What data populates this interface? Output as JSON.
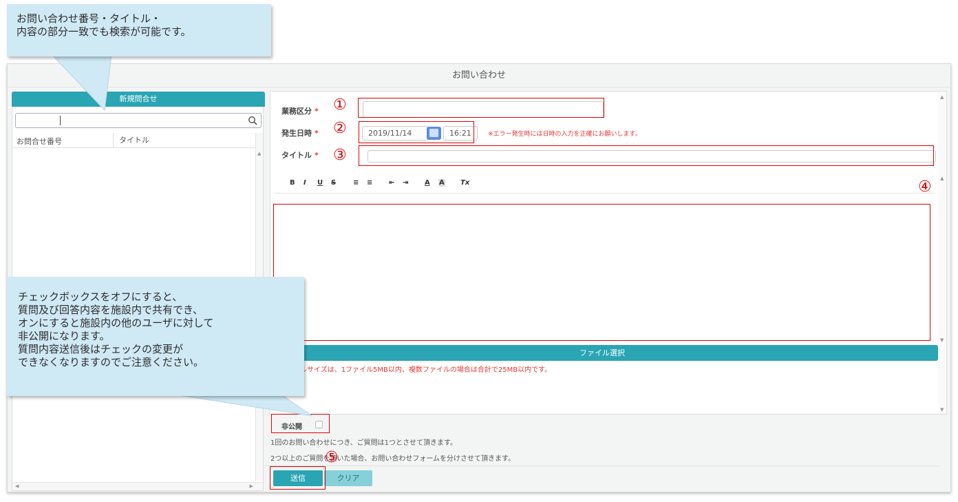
{
  "window": {
    "title": "お問い合わせ"
  },
  "left_panel": {
    "new_button": "新規問合せ",
    "search": {
      "value": "",
      "icon": "search-icon"
    },
    "columns": [
      "お問合せ番号",
      "タイトル"
    ]
  },
  "form": {
    "business_label": "業務区分",
    "date_label": "発生日時",
    "date_value": "2019/11/14",
    "time_value": "16:21",
    "error_note": "※エラー発生時には日時の入力を正確にお願いします。",
    "title_label": "タイトル",
    "required_mark": "*",
    "toolbar": {
      "bold": "B",
      "italic": "I",
      "underline": "U",
      "strike": "S",
      "ordered_list": "≡",
      "bullet_list": "≡",
      "indent_decrease": "⇤",
      "indent_increase": "⇥",
      "font_color": "A",
      "highlight": "A",
      "clear_format": "Tx"
    }
  },
  "file": {
    "button": "ファイル選択",
    "note": "能なファイルサイズは、1ファイル5MB以内、複数ファイルの場合は合計で25MB以内です。"
  },
  "private": {
    "label": "非公開",
    "checked": false
  },
  "notes": [
    "1回のお問い合わせにつき、ご質問は1つとさせて頂きます。",
    "2つ以上のご質問を頂いた場合、お問い合わせフォームを分けさせて頂きます。"
  ],
  "buttons": {
    "send": "送信",
    "clear": "クリア"
  },
  "markers": [
    "①",
    "②",
    "③",
    "④",
    "⑤"
  ],
  "callouts": [
    "お問い合わせ番号・タイトル・\n内容の部分一致でも検索が可能です。",
    "チェックボックスをオフにすると、\n質問及び回答内容を施設内で共有でき、\nオンにすると施設内の他のユーザに対して\n非公開になります。\n質問内容送信後はチェックの変更が\nできなくなりますのでご注意ください。"
  ],
  "colors": {
    "accent": "#2aa5b4",
    "error": "#e53935",
    "marker": "#e00000",
    "callout": "#cfe9f5"
  }
}
